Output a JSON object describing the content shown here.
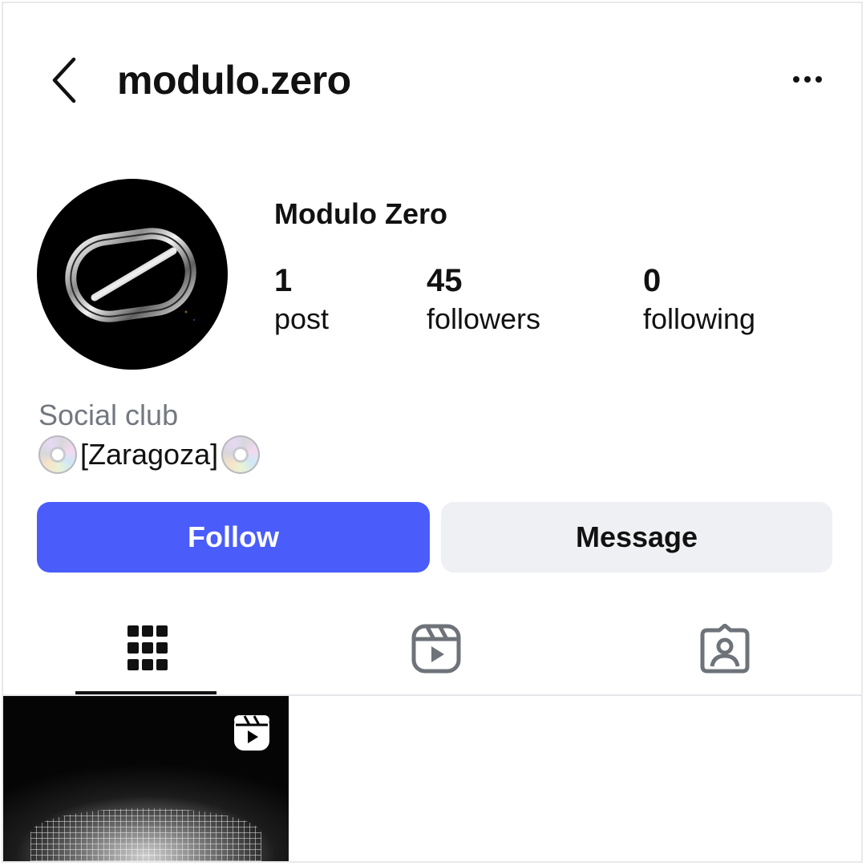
{
  "header": {
    "username": "modulo.zero"
  },
  "profile": {
    "display_name": "Modulo Zero",
    "stats": [
      {
        "value": "1",
        "label": "post"
      },
      {
        "value": "45",
        "label": "followers"
      },
      {
        "value": "0",
        "label": "following"
      }
    ],
    "category": "Social club",
    "bio_text": "[Zaragoza]"
  },
  "actions": {
    "follow_label": "Follow",
    "message_label": "Message"
  },
  "tabs": [
    {
      "icon": "grid-icon",
      "active": true
    },
    {
      "icon": "reels-icon",
      "active": false
    },
    {
      "icon": "tagged-icon",
      "active": false
    }
  ],
  "posts": [
    {
      "type": "reel"
    }
  ],
  "colors": {
    "follow_button": "#4a5dfb",
    "message_button": "#eff0f4",
    "category_text": "#737880"
  }
}
